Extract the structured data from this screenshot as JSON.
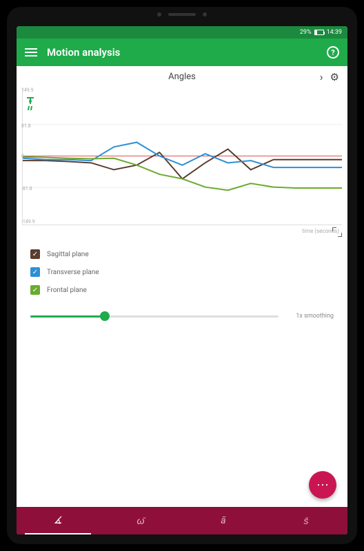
{
  "status": {
    "battery_pct": "29%",
    "time": "14:39"
  },
  "appbar": {
    "title": "Motion analysis"
  },
  "section": {
    "title": "Angles",
    "x_axis_label": "time (seconds)",
    "y_ticks": [
      "149.9",
      "81.8",
      "0",
      "-81.8",
      "-149.9"
    ]
  },
  "legend": {
    "items": [
      {
        "label": "Sagittal plane",
        "color": "#5b3d2e"
      },
      {
        "label": "Transverse plane",
        "color": "#2d8fd6"
      },
      {
        "label": "Frontal plane",
        "color": "#6aab2e"
      }
    ]
  },
  "slider": {
    "value_pct": 30,
    "label": "1x smoothing"
  },
  "bottomnav": {
    "items": [
      {
        "label": "∡",
        "active": true
      },
      {
        "label": "ω̄",
        "active": false
      },
      {
        "label": "ā",
        "active": false
      },
      {
        "label": "s̄",
        "active": false
      }
    ]
  },
  "chart_data": {
    "type": "line",
    "title": "Angles",
    "xlabel": "time (seconds)",
    "ylabel": "",
    "ylim": [
      -150,
      150
    ],
    "x": [
      0,
      1,
      2,
      3,
      4,
      5,
      6,
      7,
      8,
      9,
      10,
      11,
      12,
      13,
      14
    ],
    "series": [
      {
        "name": "Sagittal plane",
        "color": "#5b3d2e",
        "values": [
          -10,
          -10,
          -12,
          -15,
          -30,
          -20,
          8,
          -50,
          -15,
          15,
          -30,
          -8,
          -8,
          -8,
          -8
        ]
      },
      {
        "name": "Transverse plane",
        "color": "#2d8fd6",
        "values": [
          -5,
          -8,
          -8,
          -10,
          20,
          30,
          0,
          -20,
          5,
          -15,
          -10,
          -25,
          -25,
          -25,
          -25
        ]
      },
      {
        "name": "Frontal plane",
        "color": "#6aab2e",
        "values": [
          -2,
          -3,
          -5,
          -6,
          -5,
          -20,
          -40,
          -50,
          -68,
          -75,
          -60,
          -68,
          -70,
          -70,
          -70
        ]
      }
    ]
  }
}
